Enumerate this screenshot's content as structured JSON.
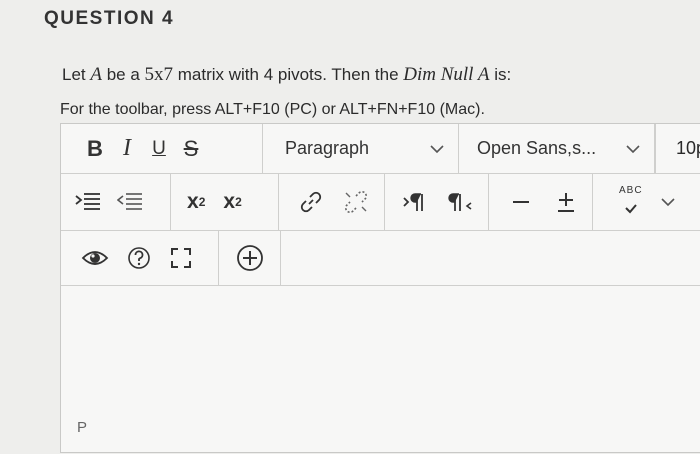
{
  "question": {
    "title": "QUESTION 4",
    "prompt_before": "Let ",
    "matrix_var": "A",
    "prompt_mid1": " be a ",
    "dims": "5x7",
    "prompt_mid2": " matrix with 4 pivots. Then the ",
    "dim_null": "Dim Null A",
    "prompt_end": " is:",
    "hint": "For the toolbar, press ALT+F10 (PC) or ALT+FN+F10 (Mac)."
  },
  "toolbar": {
    "bold": "B",
    "italic": "I",
    "underline": "U",
    "strike": "S",
    "paragraph": "Paragraph",
    "font": "Open Sans,s...",
    "font_size": "10p",
    "superscript": "x",
    "superscript_mark": "2",
    "subscript": "x",
    "subscript_mark": "2",
    "spellcheck": "ABC"
  },
  "editor": {
    "path": "P"
  }
}
